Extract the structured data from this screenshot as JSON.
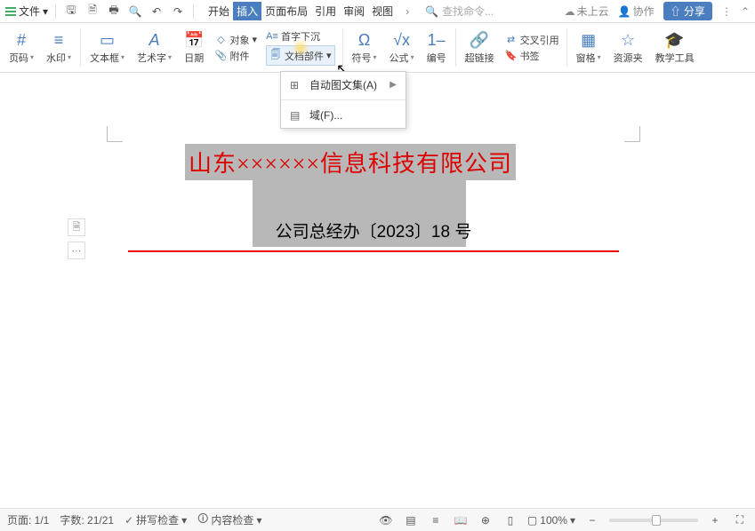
{
  "topbar": {
    "file": "文件",
    "tabs": [
      "开始",
      "插入",
      "页面布局",
      "引用",
      "审阅",
      "视图"
    ],
    "active_tab_index": 1,
    "search_placeholder": "查找命令...",
    "cloud": "未上云",
    "collab": "协作",
    "share": "分享"
  },
  "ribbon": {
    "page_number": "页码",
    "watermark": "水印",
    "textbox": "文本框",
    "wordart": "艺术字",
    "date": "日期",
    "object": "对象",
    "attachment": "附件",
    "dropcap": "首字下沉",
    "docparts": "文档部件",
    "symbol": "符号",
    "formula": "公式",
    "numbering": "编号",
    "hyperlink": "超链接",
    "crossref": "交叉引用",
    "bookmark": "书签",
    "pane": "窗格",
    "resources": "资源夹",
    "teaching": "教学工具"
  },
  "dropdown": {
    "autotext": "自动图文集(A)",
    "field": "域(F)..."
  },
  "document": {
    "title": "山东××××××信息科技有限公司",
    "subtitle_a": "公司总经办〔2023〕18",
    "subtitle_b": " 号"
  },
  "status": {
    "page": "页面: 1/1",
    "words": "字数: 21/21",
    "spellcheck": "拼写检查",
    "contentcheck": "内容检查",
    "zoom": "100%"
  }
}
